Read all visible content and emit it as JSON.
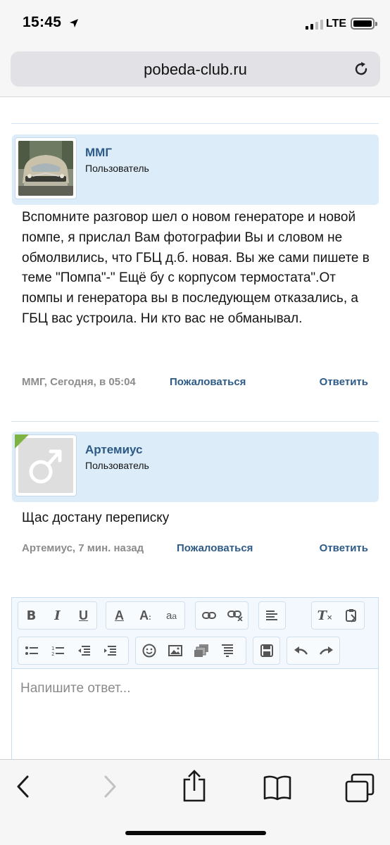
{
  "status_bar": {
    "time": "15:45",
    "network": "LTE"
  },
  "browser": {
    "url": "pobeda-club.ru"
  },
  "posts": [
    {
      "author": "ММГ",
      "role": "Пользователь",
      "message": "Вспомните разговор шел о новом генераторе и новой помпе, я прислал Вам фотографии Вы и словом не обмолвились, что ГБЦ д.б. новая. Вы же сами пишете в теме \"Помпа\"-\" Ещё бу с корпусом термостата\".От помпы и генератора вы в последующем отказались, а ГБЦ вас устроила. Ни кто вас не обманывал.",
      "meta": "ММГ, Сегодня, в 05:04",
      "report_label": "Пожаловаться",
      "reply_label": "Ответить"
    },
    {
      "author": "Артемиус",
      "role": "Пользователь",
      "message": "Щас достану переписку",
      "meta": "Артемиус, 7 мин. назад",
      "report_label": "Пожаловаться",
      "reply_label": "Ответить"
    }
  ],
  "editor": {
    "placeholder": "Напишите ответ...",
    "toolbar_row1": [
      "bold-icon",
      "italic-icon",
      "underline-icon",
      "text-color-icon",
      "font-size-icon",
      "font-family-icon",
      "link-icon",
      "unlink-icon",
      "align-icon",
      "remove-format-icon",
      "paste-icon"
    ],
    "toolbar_row2": [
      "bullet-list-icon",
      "numbered-list-icon",
      "outdent-icon",
      "indent-icon",
      "smiley-icon",
      "image-icon",
      "media-icon",
      "quote-icon",
      "save-draft-icon",
      "undo-icon",
      "redo-icon"
    ]
  },
  "colors": {
    "accent": "#2d5a86",
    "post_header_bg": "#dcecf9",
    "online_indicator": "#7cb342"
  }
}
